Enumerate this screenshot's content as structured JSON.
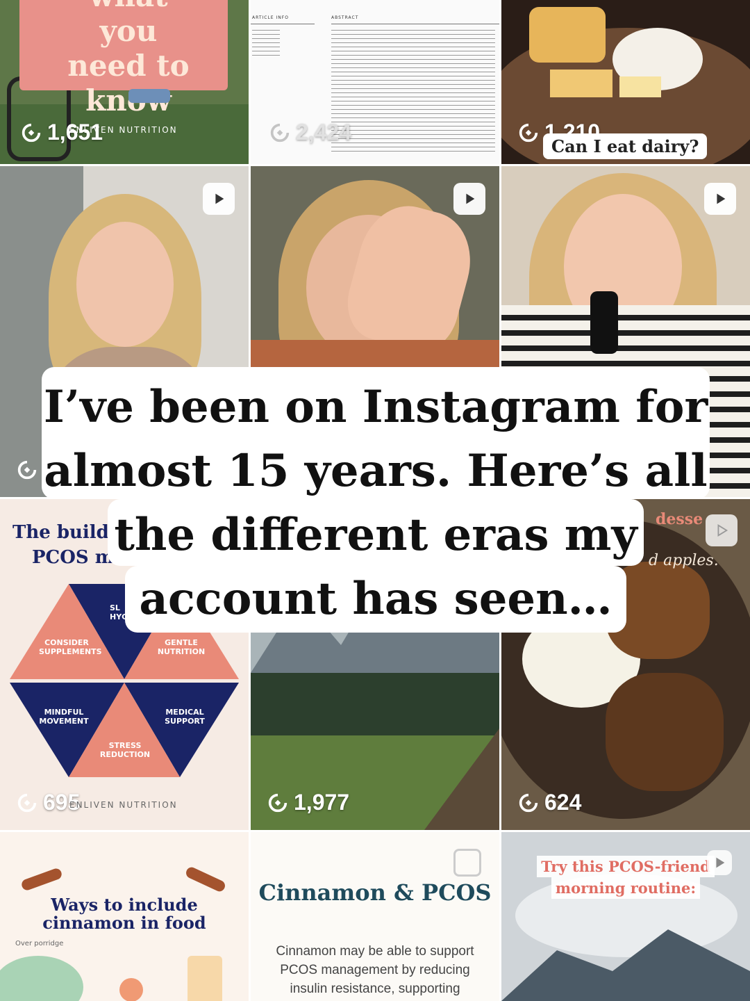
{
  "tiles": {
    "know": {
      "text_line1": "what you",
      "text_line2": "need to",
      "text_line3": "know",
      "views": "1,651",
      "brand": "ENLIVEN NUTRITION"
    },
    "paper": {
      "header_left": "ARTICLE INFO",
      "header_right": "ABSTRACT",
      "views": "2,424"
    },
    "dairy": {
      "views": "1,210",
      "label": "Can I eat dairy?"
    },
    "pyramid": {
      "title_line1": "The build",
      "title_line2": "PCOS m",
      "sections": [
        "SL HYG",
        "CONSIDER SUPPLEMENTS",
        "GENTLE NUTRITION",
        "MINDFUL MOVEMENT",
        "MEDICAL SUPPORT",
        "STRESS REDUCTION"
      ],
      "views": "695",
      "brand": "ENLIVEN NUTRITION"
    },
    "mountain": {
      "views": "1,977"
    },
    "dessert": {
      "text1": "desse",
      "text2": "d apples.",
      "views": "624"
    },
    "cinnamon_food": {
      "title_line1": "Ways to include",
      "title_line2": "cinnamon in food",
      "sub": "Over porridge"
    },
    "cinnamon_pcos": {
      "title": "Cinnamon & PCOS",
      "body_line1": "Cinnamon may be able to support",
      "body_line2": "PCOS management by reducing",
      "body_line3": "insulin resistance, supporting"
    },
    "routine": {
      "line1": "Try this PCOS-friend",
      "line2": "morning routine:"
    }
  },
  "caption": {
    "line1": "I’ve been on Instagram for",
    "line2": "almost 15 years. Here’s all",
    "line3": "the different eras my",
    "line4": "account has seen…"
  },
  "icons": {
    "views": "eye-icon",
    "reel": "play-icon",
    "carousel": "carousel-icon"
  },
  "colors": {
    "salmon": "#e98a78",
    "navy": "#1a2466",
    "cream": "#f6ebe4",
    "teal": "#1f4b5c"
  }
}
